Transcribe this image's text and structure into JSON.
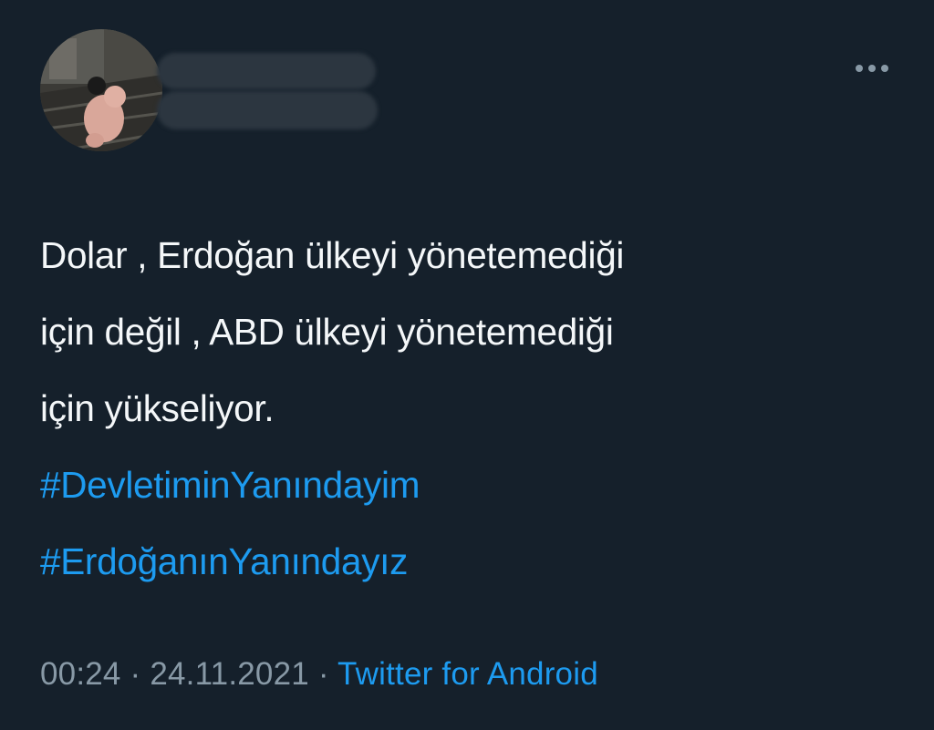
{
  "tweet": {
    "text_lines": [
      "Dolar , Erdoğan ülkeyi yönetemediği",
      "için değil , ABD ülkeyi yönetemediği",
      "için yükseliyor."
    ],
    "hashtags": [
      "#DevletiminYanındayim",
      "#ErdoğanınYanındayız"
    ],
    "time": "00:24",
    "separator": "·",
    "date": "24.11.2021",
    "source": "Twitter for Android"
  },
  "icons": {
    "more": "more-horizontal-icon",
    "avatar": "avatar-image"
  },
  "colors": {
    "background": "#15202b",
    "text": "#f4f7f9",
    "link": "#1d9bf0",
    "muted": "#8899a6"
  }
}
